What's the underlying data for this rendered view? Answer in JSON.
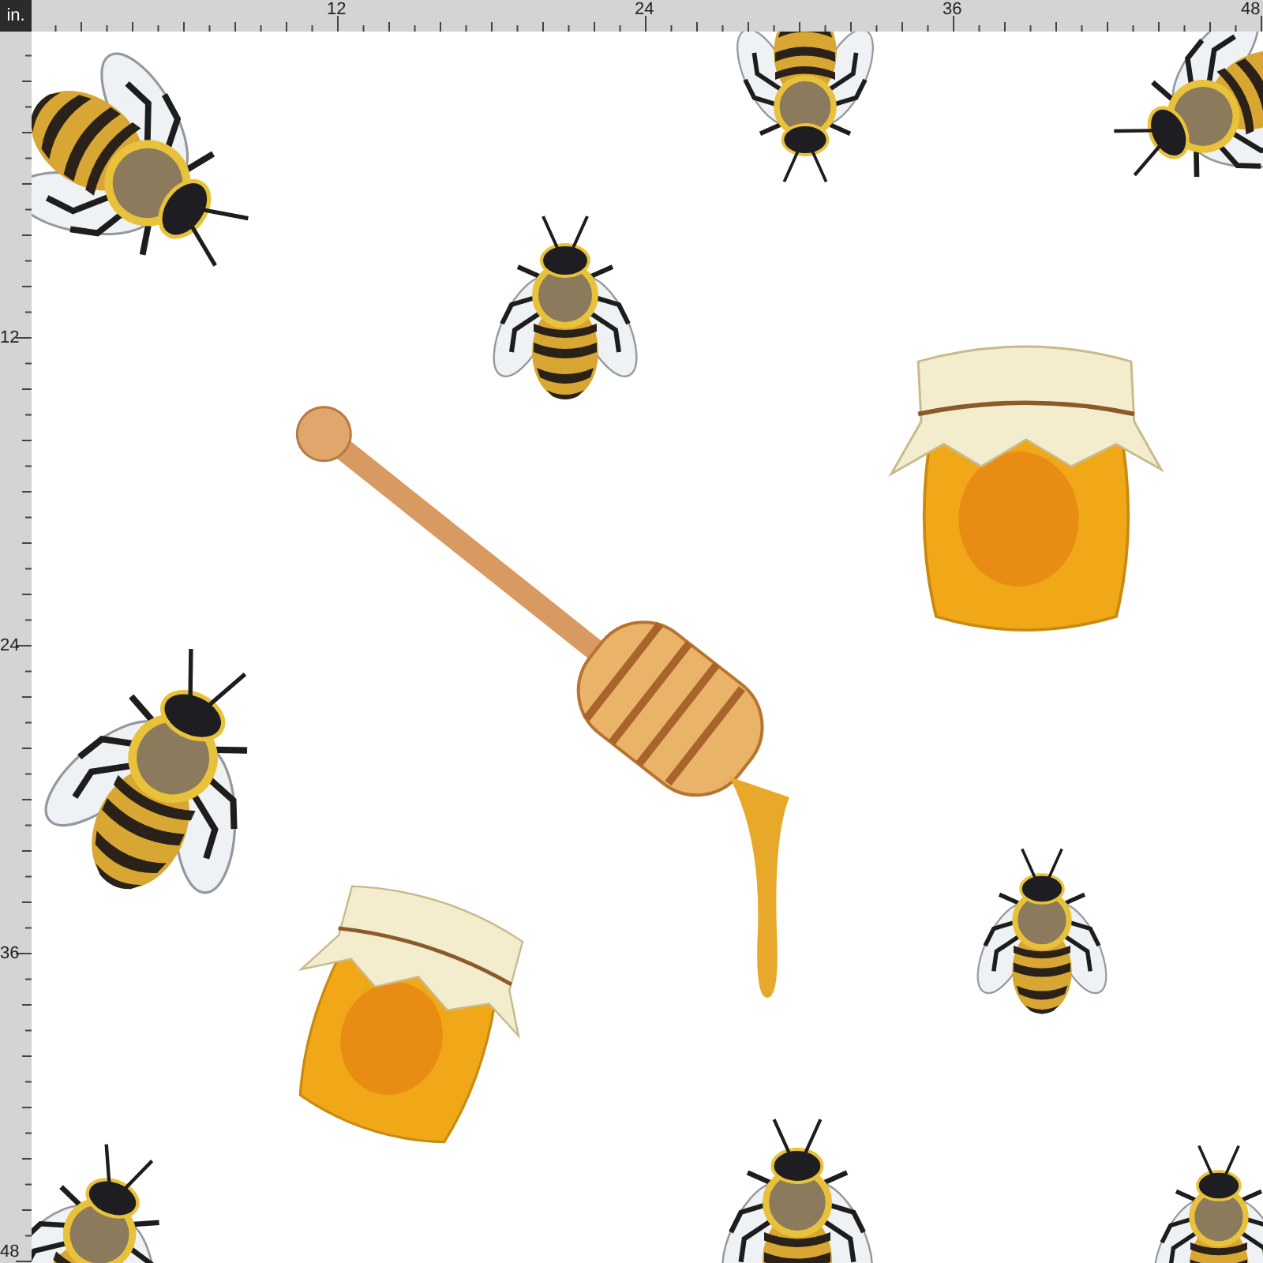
{
  "ruler_unit": "in.",
  "top_ruler": {
    "labels": [
      "12",
      "24",
      "36",
      "48"
    ]
  },
  "left_ruler": {
    "labels": [
      "12",
      "24",
      "36",
      "48"
    ]
  }
}
